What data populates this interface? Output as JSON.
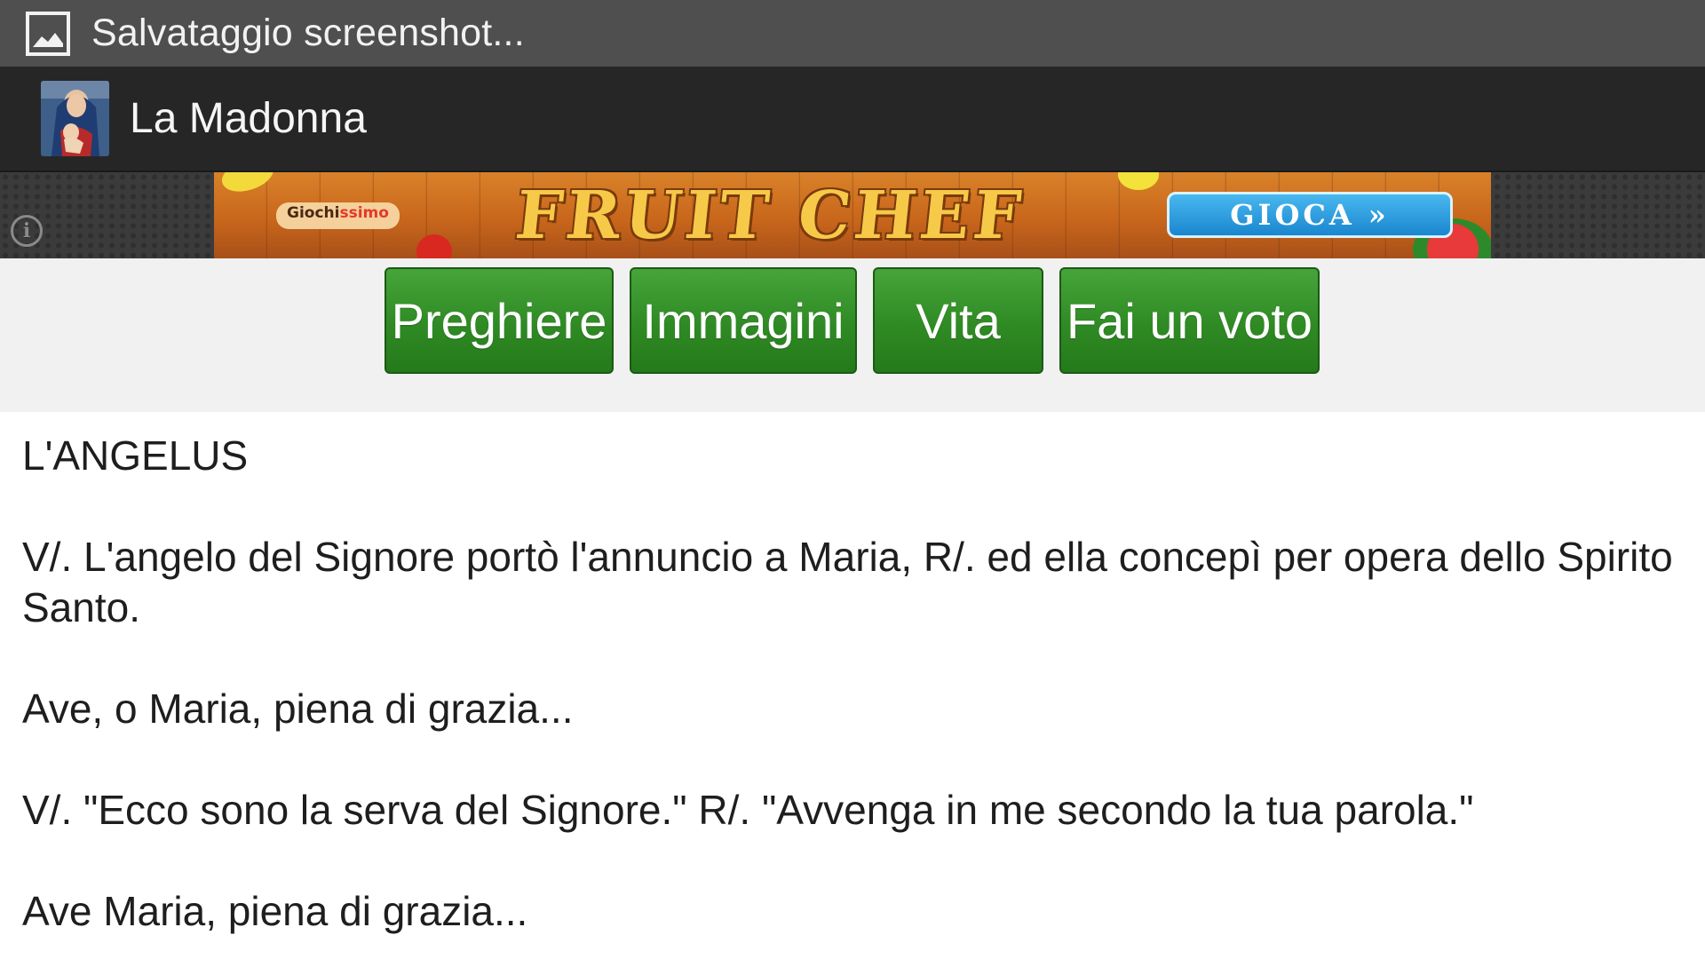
{
  "status_bar": {
    "icon": "image-icon",
    "text": "Salvataggio screenshot..."
  },
  "action_bar": {
    "icon": "madonna-app-icon",
    "title": "La Madonna"
  },
  "ad": {
    "brand_prefix": "Giochi",
    "brand_suffix": "ssimo",
    "title": "FRUIT CHEF",
    "cta": "GIOCA »",
    "info_icon": "info-icon"
  },
  "nav": {
    "buttons": [
      {
        "label": "Preghiere"
      },
      {
        "label": "Immagini"
      },
      {
        "label": "Vita"
      },
      {
        "label": "Fai un voto"
      }
    ]
  },
  "content": {
    "paragraphs": [
      "L'ANGELUS",
      "V/. L'angelo del Signore portò l'annuncio a Maria, R/. ed ella concepì per opera dello Spirito Santo.",
      "Ave, o Maria, piena di grazia...",
      "V/. \"Ecco sono la serva del Signore.\" R/. \"Avvenga in me secondo la tua parola.\"",
      "Ave Maria, piena di grazia..."
    ]
  },
  "colors": {
    "status_bar": "#4f4f4f",
    "action_bar": "#262626",
    "button_green": "#2f8a24",
    "button_row_bg": "#f1f1f1"
  }
}
